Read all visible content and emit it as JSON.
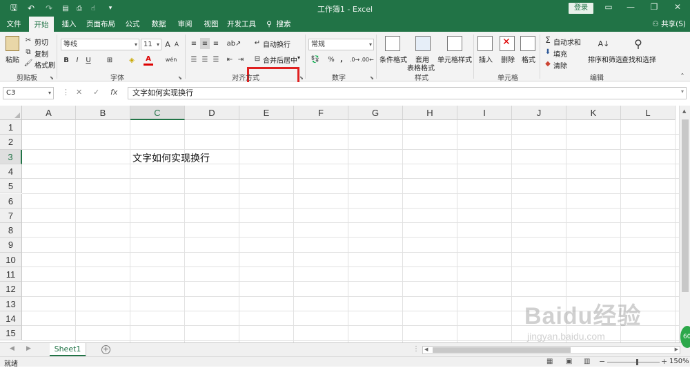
{
  "titlebar": {
    "title": "工作簿1  -  Excel",
    "login": "登录",
    "qat": {
      "save": "🖫",
      "undo": "↶",
      "redo": "↷",
      "more": "▾"
    }
  },
  "tabs": [
    "文件",
    "开始",
    "插入",
    "页面布局",
    "公式",
    "数据",
    "审阅",
    "视图",
    "开发工具",
    "搜索"
  ],
  "share": "共享(S)",
  "ribbon": {
    "clipboard": {
      "paste": "粘贴",
      "cut": "剪切",
      "copy": "复制",
      "format_painter": "格式刷",
      "label": "剪贴板"
    },
    "font": {
      "name": "等线",
      "size": "11",
      "bold": "B",
      "italic": "I",
      "underline": "U",
      "label": "字体"
    },
    "alignment": {
      "wrap_text": "自动换行",
      "merge_center": "合并后居中",
      "label": "对齐方式"
    },
    "number": {
      "format": "常规",
      "percent": "%",
      "comma": ",",
      "label": "数字"
    },
    "styles": {
      "conditional": "条件格式",
      "table_line1": "套用",
      "table_line2": "表格格式",
      "cell_styles": "单元格样式",
      "label": "样式"
    },
    "cells": {
      "insert": "插入",
      "delete": "删除",
      "format": "格式",
      "label": "单元格"
    },
    "editing": {
      "autosum": "自动求和",
      "fill": "填充",
      "clear": "清除",
      "sort": "排序和筛选",
      "find": "查找和选择",
      "label": "编辑"
    }
  },
  "formula_bar": {
    "name_box": "C3",
    "fx": "fx",
    "content": "文字如何实现换行"
  },
  "columns": [
    "A",
    "B",
    "C",
    "D",
    "E",
    "F",
    "G",
    "H",
    "I",
    "J",
    "K",
    "L"
  ],
  "rows": [
    "1",
    "2",
    "3",
    "4",
    "5",
    "6",
    "7",
    "8",
    "9",
    "10",
    "11",
    "12",
    "13",
    "14",
    "15"
  ],
  "cells": {
    "C3": "文字如何实现换行"
  },
  "sheets": [
    "Sheet1"
  ],
  "status": {
    "ready": "就绪",
    "zoom": "150%"
  },
  "watermark": {
    "main": "Baidu经验",
    "sub": "jingyan.baidu.com"
  },
  "colors": {
    "accent": "#217346",
    "highlight": "#e02020"
  }
}
